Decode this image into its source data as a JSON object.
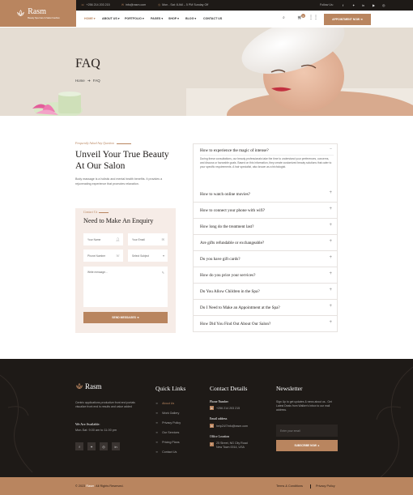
{
  "topbar": {
    "phone": "+256 214 203 215",
    "email": "info@rasm.com",
    "hours": "Mon - Sat: 8 AM – 5 PM Sunday Off",
    "follow": "Follow Us:",
    "social_icons": [
      "facebook-icon",
      "twitter-icon",
      "linkedin-icon",
      "youtube-icon",
      "instagram-icon"
    ]
  },
  "brand": {
    "name": "Rasm",
    "tagline": "Beauty Spa Care & Salon Fashion"
  },
  "nav": {
    "items": [
      "HOME",
      "ABOUT US",
      "PORTFOLIO",
      "PAGES",
      "SHOP",
      "BLOG",
      "CONTACT US"
    ],
    "cart_count": "0",
    "appointment": "APPOINTMENT NOW"
  },
  "hero": {
    "title": "FAQ",
    "crumb_home": "Home",
    "crumb_current": "FAQ"
  },
  "intro": {
    "tag": "Frequently Asked Any Question",
    "title_line1": "Unveil Your True Beauty",
    "title_line2": "At Our Salon",
    "body": "Body massage is a holistic and mental health benefits. It provides a rejuvenating experience that promotes relaxation."
  },
  "enquiry": {
    "tag": "Contact Us",
    "title": "Need to Make An Enquiry",
    "name_ph": "Your Name",
    "email_ph": "Your Email",
    "phone_ph": "Phone Number",
    "subject_ph": "Select Subject",
    "message_ph": "Write message...",
    "send": "SEND MESSAGES"
  },
  "faq": {
    "items": [
      {
        "q": "How to experience the magic of intense?",
        "a": "During these consultations, our beauty professionals take the time to understand your preferences, concerns, and discuss ur favorable goals. Based on this information, they create customized beauty solutions that cater to your specific requirements. A hair specialist, also known as a trichologist."
      },
      {
        "q": "How to watch online movies?"
      },
      {
        "q": "How to connect your phone with wifi?"
      },
      {
        "q": "How long do the treatment last?"
      },
      {
        "q": "Are gifts refundable or exchangeable?"
      },
      {
        "q": "Do you have gift cards?"
      },
      {
        "q": "How do you price your services?"
      },
      {
        "q": "Do You Allow Children in the Spa?"
      },
      {
        "q": "Do I Need to Make an Appointment at the Spa?"
      },
      {
        "q": "How Did You Find Out About Our Salon?"
      }
    ]
  },
  "footer": {
    "brand": "Rasm",
    "about": "Centric applications productize front end portals visualize front end is results and value added",
    "available_title": "We Are Available:",
    "available_hours": "Mon-Sat: 9.00 am to 11.00 pm",
    "social_icons": [
      "facebook-icon",
      "twitter-icon",
      "instagram-icon",
      "linkedin-icon"
    ],
    "quick_links_title": "Quick Links",
    "quick_links": [
      "About Us",
      "Work Gallery",
      "Privacy Policy",
      "Our Services",
      "Pricing Plans",
      "Contact Us"
    ],
    "contact_title": "Contact Details",
    "phone_label": "Phone Number",
    "phone": "+256 214 203 215",
    "email_label": "Email address",
    "email": "help24/7info@rasm.com",
    "location_label": "Office Location",
    "location_line1": "25 Street, NG City Road",
    "location_line2": "New Town 0014, USA",
    "newsletter_title": "Newsletter",
    "newsletter_text": "Sign Up to get updates & news about us.. Get Latest Deals from Walker's Inbox to our mail address.",
    "email_ph": "Enter your email",
    "subscribe": "SUBSCRIBE NOW"
  },
  "copyright": {
    "text_prefix": "© 2023 ",
    "brand": "Rasm",
    "text_suffix": ". All Rights Reserved.",
    "terms": "Terms & Conditions",
    "privacy": "Privacy Policy"
  },
  "colors": {
    "accent": "#b9855f",
    "dark": "#1e1a17",
    "enquiry_bg": "#f6ece7"
  }
}
